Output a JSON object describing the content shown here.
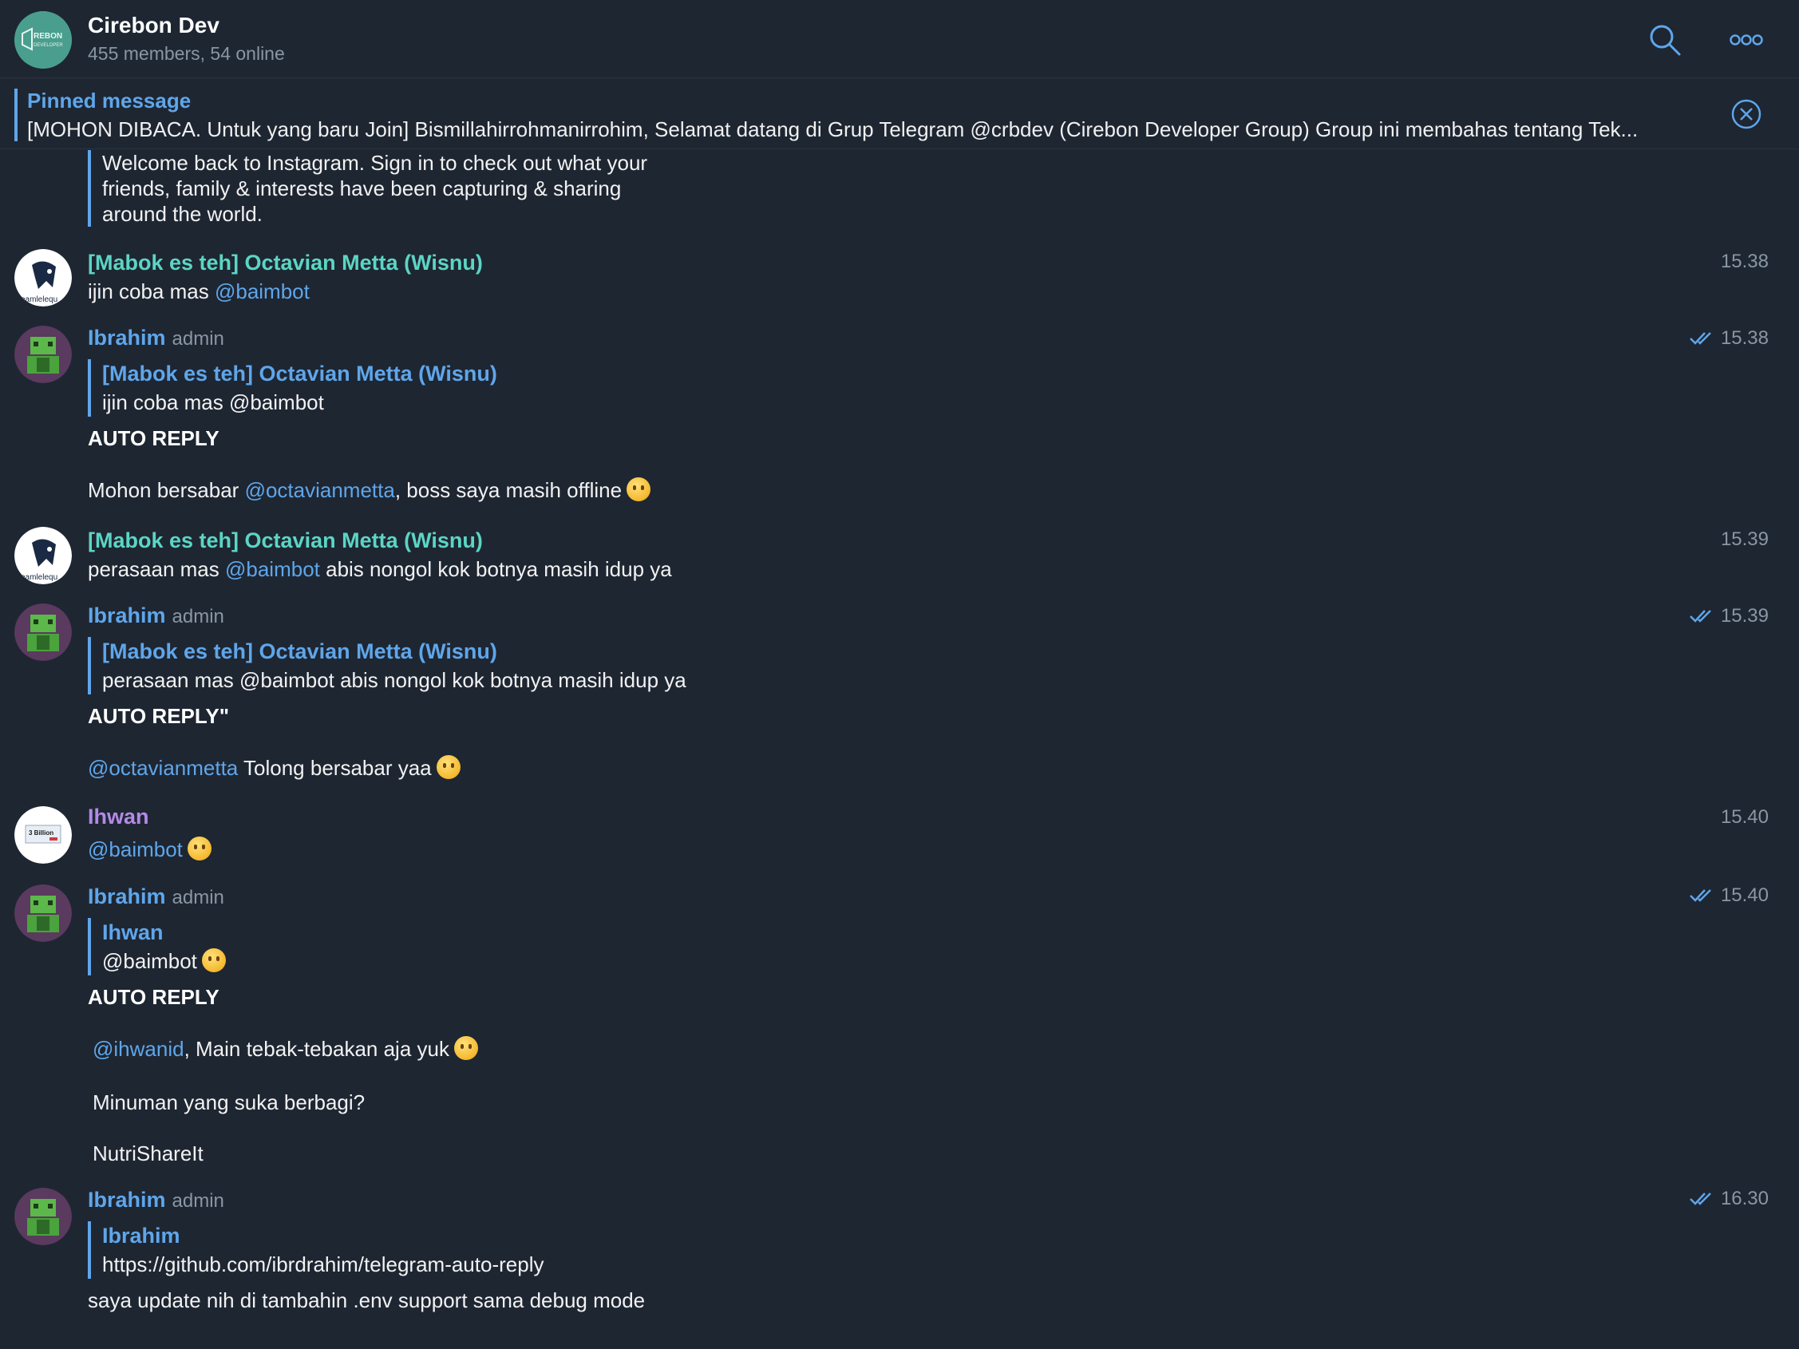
{
  "header": {
    "title": "Cirebon Dev",
    "subtitle": "455 members, 54 online",
    "avatar_text": "CIREBON DEVELOPER"
  },
  "pinned": {
    "title": "Pinned message",
    "text": "[MOHON DIBACA. Untuk yang baru Join]   Bismillahirrohmanirrohim, Selamat datang di Grup Telegram @crbdev (Cirebon Developer Group) Group ini membahas tentang Tek..."
  },
  "top_quote": {
    "lines": [
      "Welcome back to Instagram. Sign in to check out what your",
      "friends, family & interests have been capturing & sharing",
      "around the world."
    ]
  },
  "messages": [
    {
      "name": "[Mabok es teh] Octavian Metta (Wisnu)",
      "time": "15.38",
      "text_prefix": "ijin coba mas ",
      "mention": "@baimbot",
      "text_suffix": ""
    },
    {
      "name": "Ibrahim",
      "role": "admin",
      "time": "15.38",
      "reply_name": "[Mabok es teh] Octavian Metta (Wisnu)",
      "reply_text": "ijin coba mas @baimbot",
      "heading": "AUTO REPLY",
      "body_prefix": "Mohon bersabar ",
      "body_mention": "@octavianmetta",
      "body_suffix": ", boss saya masih offline"
    },
    {
      "name": "[Mabok es teh] Octavian Metta (Wisnu)",
      "time": "15.39",
      "text_prefix": "perasaan mas ",
      "mention": "@baimbot",
      "text_suffix": " abis nongol kok botnya masih idup ya"
    },
    {
      "name": "Ibrahim",
      "role": "admin",
      "time": "15.39",
      "reply_name": "[Mabok es teh] Octavian Metta (Wisnu)",
      "reply_text": "perasaan mas @baimbot abis nongol kok botnya masih idup ya",
      "heading": "AUTO REPLY\"",
      "body_mention": "@octavianmetta",
      "body_suffix": " Tolong bersabar yaa"
    },
    {
      "name": "Ihwan",
      "time": "15.40",
      "mention": "@baimbot"
    },
    {
      "name": "Ibrahim",
      "role": "admin",
      "time": "15.40",
      "reply_name": "Ihwan",
      "reply_text": "@baimbot",
      "heading": "AUTO REPLY",
      "body_mention": "@ihwanid",
      "body_suffix": ", Main tebak-tebakan aja yuk",
      "line2": "Minuman yang suka berbagi?",
      "line3": "NutriShareIt"
    },
    {
      "name": "Ibrahim",
      "role": "admin",
      "time": "16.30",
      "reply_name": "Ibrahim",
      "reply_text": "https://github.com/ibrdrahim/telegram-auto-reply",
      "body": "saya update nih di tambahin .env support sama debug mode"
    }
  ],
  "icons": {
    "search": "search-icon",
    "more": "more-icon",
    "close": "close-icon",
    "read": "double-check-icon"
  },
  "colors": {
    "background": "#1e2632",
    "accent": "#5fa6ea",
    "teal_name": "#5cd5c4",
    "purple_name": "#b28ae6"
  }
}
